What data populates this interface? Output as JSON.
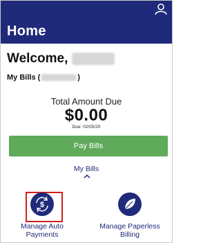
{
  "header": {
    "title": "Home",
    "user_icon": "user-icon"
  },
  "welcome": {
    "label": "Welcome,"
  },
  "bills": {
    "label_prefix": "My Bills (",
    "label_suffix": ")"
  },
  "amount": {
    "label": "Total Amount Due",
    "value": "$0.00",
    "due": "Due: 02/05/20"
  },
  "pay_button": {
    "label": "Pay Bills"
  },
  "bills_toggle": {
    "label": "My Bills",
    "icon": "chevron-up-icon"
  },
  "tiles": [
    {
      "label": "Manage Auto Payments",
      "icon": "autopay-dollar-icon"
    },
    {
      "label": "Manage Paperless Billing",
      "icon": "leaf-icon"
    }
  ],
  "colors": {
    "brand": "#1f2a7a",
    "pay": "#5faa5b",
    "highlight": "#d11d1d"
  }
}
